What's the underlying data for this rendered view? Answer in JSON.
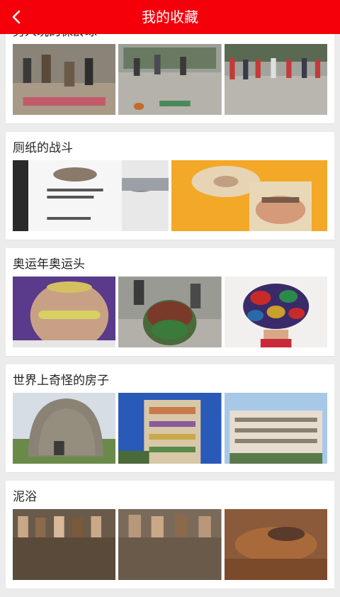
{
  "header": {
    "title": "我的收藏",
    "back_icon": "chevron-left-icon"
  },
  "collections": [
    {
      "title": "男人玩的保龄球",
      "thumb_count": 3
    },
    {
      "title": "厕纸的战斗",
      "thumb_count": 2
    },
    {
      "title": "奥运年奥运头",
      "thumb_count": 3
    },
    {
      "title": "世界上奇怪的房子",
      "thumb_count": 3
    },
    {
      "title": "泥浴",
      "thumb_count": 3
    }
  ],
  "colors": {
    "header": "#f5000a",
    "background": "#ececec"
  }
}
